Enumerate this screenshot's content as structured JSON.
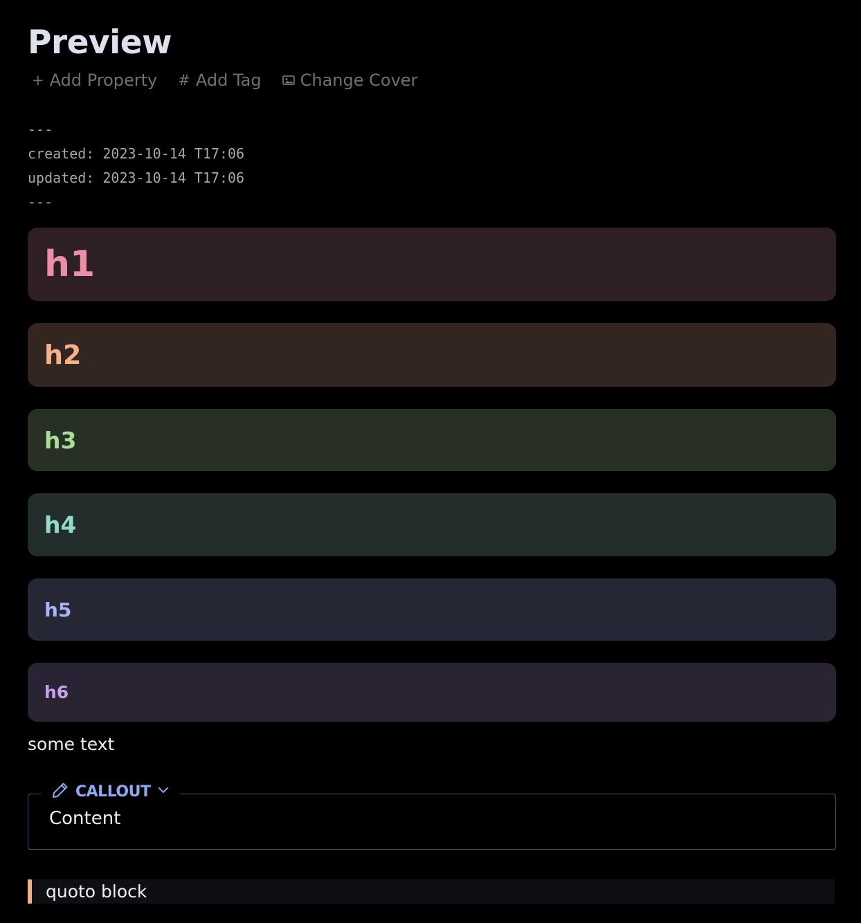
{
  "page": {
    "title": "Preview"
  },
  "actions": [
    {
      "label": "Add Property",
      "icon": "plus-icon",
      "glyph": "+"
    },
    {
      "label": "Add Tag",
      "icon": "hash-icon",
      "glyph": "#"
    },
    {
      "label": "Change Cover",
      "icon": "image-icon",
      "glyph": ""
    }
  ],
  "frontmatter": {
    "open_delimiter": "---",
    "created": "created: 2023-10-14 T17:06",
    "updated": "updated: 2023-10-14 T17:06",
    "close_delimiter": "---"
  },
  "headings": [
    {
      "text": "h1",
      "color": "#ec8ea5",
      "background": "#2e1f25"
    },
    {
      "text": "h2",
      "color": "#f4b28a",
      "background": "#33251f"
    },
    {
      "text": "h3",
      "color": "#a7dd99",
      "background": "#282f24"
    },
    {
      "text": "h4",
      "color": "#92dcc7",
      "background": "#232d2c"
    },
    {
      "text": "h5",
      "color": "#a7b3f3",
      "background": "#262735"
    },
    {
      "text": "h6",
      "color": "#c4a2ee",
      "background": "#2a2333"
    }
  ],
  "body_text": "some text",
  "callout": {
    "title": "CALLOUT",
    "icon": "pencil-icon",
    "toggle_icon": "chevron-down-icon",
    "content": "Content",
    "accent": "#8ea8f2"
  },
  "quote": {
    "text": "quoto block",
    "accent": "#f2b08a"
  }
}
